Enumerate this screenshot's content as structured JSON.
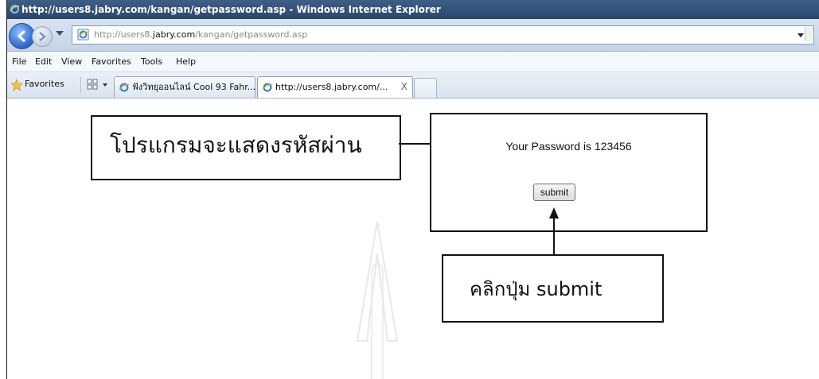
{
  "window": {
    "title": "http://users8.jabry.com/kangan/getpassword.asp - Windows Internet Explorer"
  },
  "address_bar": {
    "url_prefix": "http://users8.",
    "url_domain": "jabry.com",
    "url_path": "/kangan/getpassword.asp"
  },
  "menu": {
    "items": [
      "File",
      "Edit",
      "View",
      "Favorites",
      "Tools",
      "Help"
    ]
  },
  "favorites_bar": {
    "favorites_label": "Favorites"
  },
  "tabs": [
    {
      "label": "ฟังวิทยุออนไลน์ Cool 93 Fahr..."
    },
    {
      "label": "http://users8.jabry.com/...",
      "close": "X"
    }
  ],
  "page": {
    "password_text": "Your Password is 123456",
    "submit_label": "submit"
  },
  "annotations": {
    "program_shows_password": "โปรแกรมจะแสดงรหัสผ่าน",
    "click_submit": "คลิกปุ่ม submit"
  },
  "colors": {
    "titlebar": "#2b466b",
    "callout_border": "#111111"
  }
}
